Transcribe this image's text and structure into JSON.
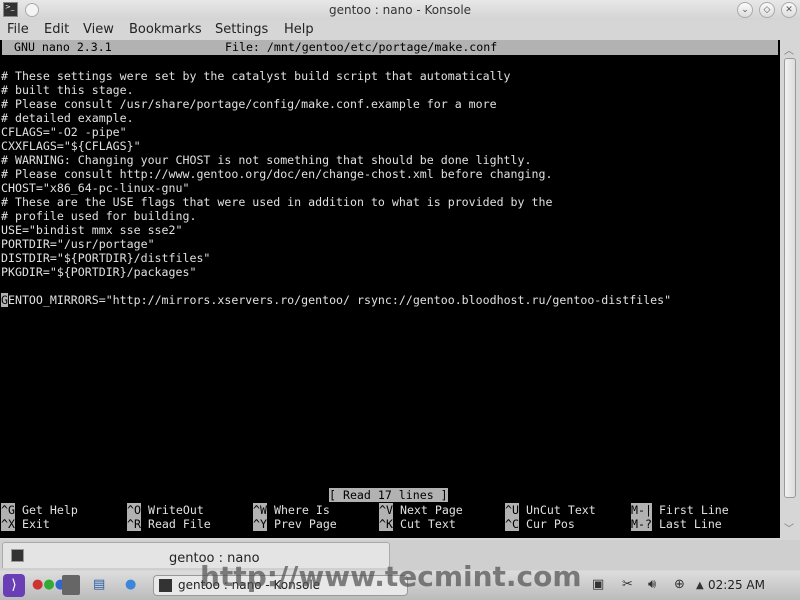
{
  "window": {
    "title": "gentoo : nano - Konsole"
  },
  "menu": [
    "File",
    "Edit",
    "View",
    "Bookmarks",
    "Settings",
    "Help"
  ],
  "nano": {
    "version": "GNU nano 2.3.1",
    "file": "File: /mnt/gentoo/etc/portage/make.conf",
    "lines": [
      "# These settings were set by the catalyst build script that automatically",
      "# built this stage.",
      "# Please consult /usr/share/portage/config/make.conf.example for a more",
      "# detailed example.",
      "CFLAGS=\"-O2 -pipe\"",
      "CXXFLAGS=\"${CFLAGS}\"",
      "# WARNING: Changing your CHOST is not something that should be done lightly.",
      "# Please consult http://www.gentoo.org/doc/en/change-chost.xml before changing.",
      "CHOST=\"x86_64-pc-linux-gnu\"",
      "# These are the USE flags that were used in addition to what is provided by the",
      "# profile used for building.",
      "USE=\"bindist mmx sse sse2\"",
      "PORTDIR=\"/usr/portage\"",
      "DISTDIR=\"${PORTDIR}/distfiles\"",
      "PKGDIR=\"${PORTDIR}/packages\"",
      ""
    ],
    "cursor_char": "G",
    "last_line_rest": "ENTOO_MIRRORS=\"http://mirrors.xservers.ro/gentoo/ rsync://gentoo.bloodhost.ru/gentoo-distfiles\"",
    "status": "[ Read 17 lines ]",
    "shortcuts": [
      {
        "key": "^G",
        "label": "Get Help"
      },
      {
        "key": "^O",
        "label": "WriteOut"
      },
      {
        "key": "^W",
        "label": "Where Is"
      },
      {
        "key": "^V",
        "label": "Next Page"
      },
      {
        "key": "^U",
        "label": "UnCut Text"
      },
      {
        "key": "M-|",
        "label": "First Line"
      },
      {
        "key": "^X",
        "label": "Exit"
      },
      {
        "key": "^R",
        "label": "Read File"
      },
      {
        "key": "^Y",
        "label": "Prev Page"
      },
      {
        "key": "^K",
        "label": "Cut Text"
      },
      {
        "key": "^C",
        "label": "Cur Pos"
      },
      {
        "key": "M-?",
        "label": "Last Line"
      }
    ]
  },
  "tab": {
    "label": "gentoo : nano"
  },
  "taskbar": {
    "task": "gentoo : nano - Konsole",
    "clock": "02:25 AM"
  },
  "watermark": "http://www.tecmint.com"
}
